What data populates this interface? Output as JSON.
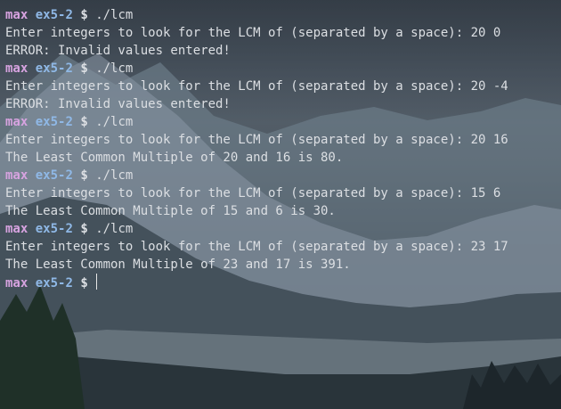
{
  "prompt": {
    "user": "max",
    "dir": "ex5-2",
    "symbol": "$"
  },
  "lines": [
    {
      "type": "prompt",
      "command": "./lcm"
    },
    {
      "type": "output",
      "text": "Enter integers to look for the LCM of (separated by a space): 20 0"
    },
    {
      "type": "output",
      "text": "ERROR: Invalid values entered!"
    },
    {
      "type": "prompt",
      "command": "./lcm"
    },
    {
      "type": "output",
      "text": "Enter integers to look for the LCM of (separated by a space): 20 -4"
    },
    {
      "type": "output",
      "text": "ERROR: Invalid values entered!"
    },
    {
      "type": "prompt",
      "command": "./lcm"
    },
    {
      "type": "output",
      "text": "Enter integers to look for the LCM of (separated by a space): 20 16"
    },
    {
      "type": "output",
      "text": "The Least Common Multiple of 20 and 16 is 80."
    },
    {
      "type": "prompt",
      "command": "./lcm"
    },
    {
      "type": "output",
      "text": "Enter integers to look for the LCM of (separated by a space): 15 6"
    },
    {
      "type": "output",
      "text": "The Least Common Multiple of 15 and 6 is 30."
    },
    {
      "type": "prompt",
      "command": "./lcm"
    },
    {
      "type": "output",
      "text": "Enter integers to look for the LCM of (separated by a space): 23 17"
    },
    {
      "type": "output",
      "text": "The Least Common Multiple of 23 and 17 is 391."
    },
    {
      "type": "prompt",
      "command": ""
    }
  ],
  "colors": {
    "user": "#d7a3e0",
    "dir": "#8fb8e6",
    "text": "#dcdfe3"
  }
}
